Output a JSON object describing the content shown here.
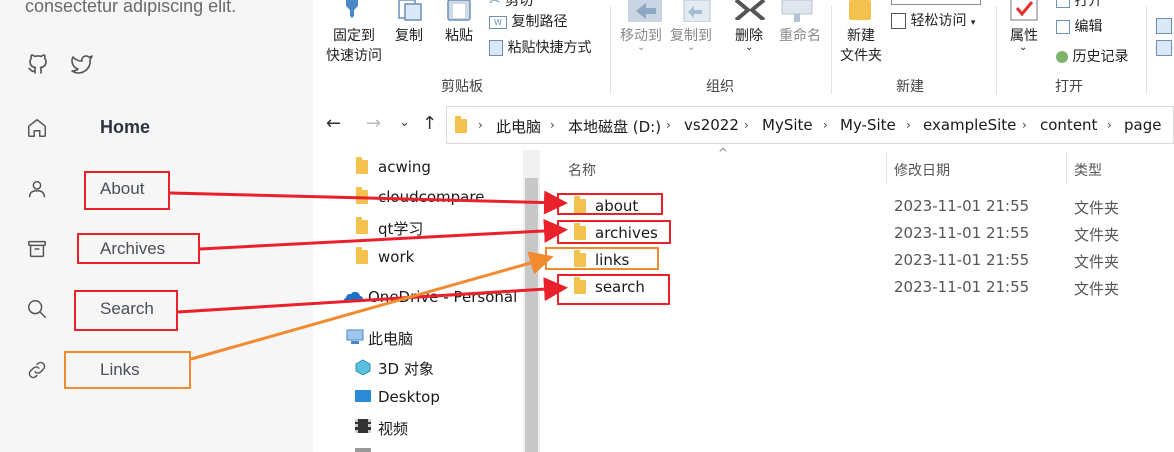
{
  "site": {
    "tagline": "consectetur adipiscing elit.",
    "social": [
      {
        "icon": "github-icon"
      },
      {
        "icon": "twitter-icon"
      }
    ],
    "nav": [
      {
        "label": "Home",
        "icon": "home-icon"
      },
      {
        "label": "About",
        "icon": "user-icon"
      },
      {
        "label": "Archives",
        "icon": "archive-icon"
      },
      {
        "label": "Search",
        "icon": "search-icon"
      },
      {
        "label": "Links",
        "icon": "link-icon"
      }
    ]
  },
  "ribbon": {
    "clipboard": {
      "pin": "固定到\n快速访问",
      "copy": "复制",
      "paste": "粘贴",
      "cut_partial": "剪切",
      "copy_path": "复制路径",
      "paste_shortcut": "粘贴快捷方式",
      "group": "剪贴板"
    },
    "organize": {
      "move_to": "移动到",
      "copy_to": "复制到",
      "delete": "删除",
      "rename": "重命名",
      "group": "组织"
    },
    "new": {
      "new_folder": "新建\n文件夹",
      "easy_access": "轻松访问",
      "group": "新建"
    },
    "open": {
      "properties": "属性",
      "open": "打开",
      "edit": "编辑",
      "history": "历史记录",
      "group": "打开"
    }
  },
  "address": {
    "crumbs": [
      "此电脑",
      "本地磁盘 (D:)",
      "vs2022",
      "MySite",
      "My-Site",
      "exampleSite",
      "content",
      "page"
    ]
  },
  "navpane": {
    "items": [
      {
        "label": "acwing",
        "icon": "folder-icon"
      },
      {
        "label": "cloudcompare",
        "icon": "folder-icon"
      },
      {
        "label": "qt学习",
        "icon": "folder-icon"
      },
      {
        "label": "work",
        "icon": "folder-icon"
      },
      {
        "label": "OneDrive - Personal",
        "icon": "onedrive-icon"
      },
      {
        "label": "此电脑",
        "icon": "computer-icon"
      },
      {
        "label": "3D 对象",
        "icon": "3d-objects-icon"
      },
      {
        "label": "Desktop",
        "icon": "desktop-icon"
      },
      {
        "label": "视频",
        "icon": "video-icon"
      }
    ]
  },
  "content": {
    "columns": {
      "name": "名称",
      "date": "修改日期",
      "type": "类型"
    },
    "rows": [
      {
        "name": "about",
        "date": "2023-11-01 21:55",
        "type": "文件夹"
      },
      {
        "name": "archives",
        "date": "2023-11-01 21:55",
        "type": "文件夹"
      },
      {
        "name": "links",
        "date": "2023-11-01 21:55",
        "type": "文件夹"
      },
      {
        "name": "search",
        "date": "2023-11-01 21:55",
        "type": "文件夹"
      }
    ]
  },
  "colors": {
    "annotation_red": "#e8212b",
    "annotation_orange": "#f28a30",
    "folder_yellow": "#f2c14e"
  }
}
